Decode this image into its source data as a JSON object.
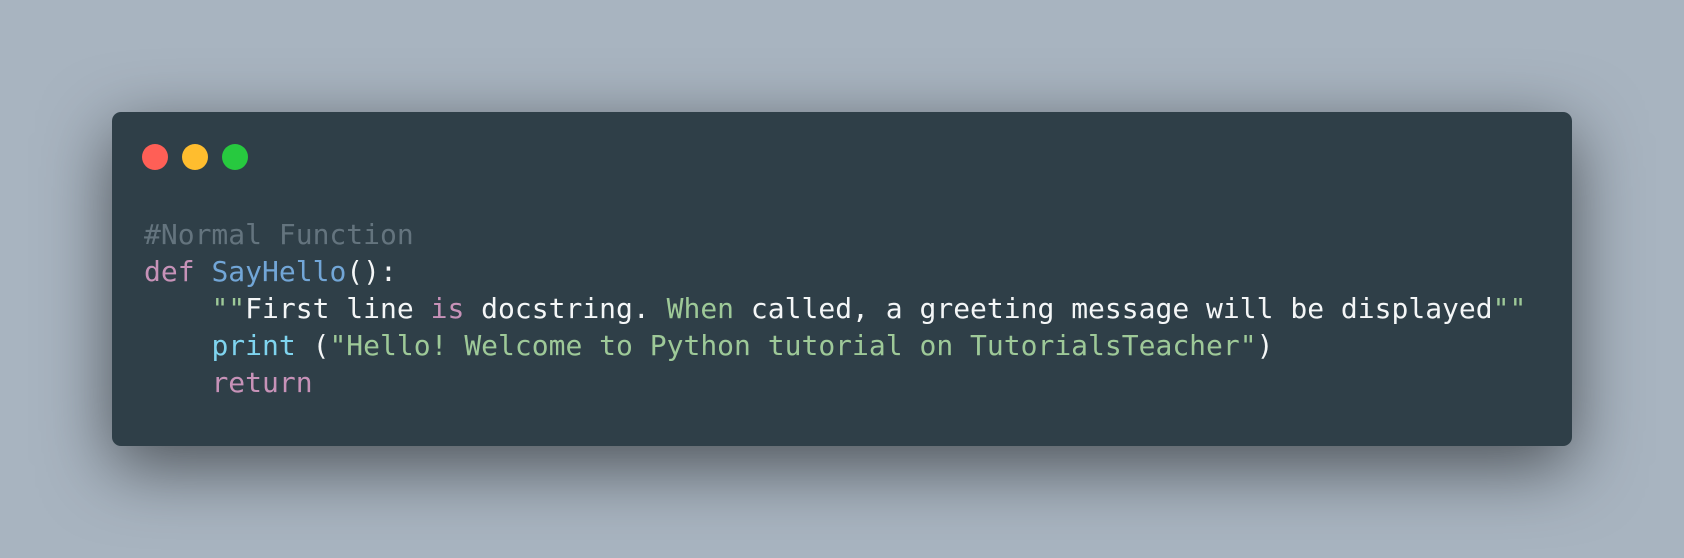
{
  "window": {
    "controls": {
      "close": "close",
      "minimize": "minimize",
      "maximize": "maximize"
    }
  },
  "code": {
    "comment": "#Normal Function",
    "line2": {
      "kw": "def",
      "fn": "SayHello",
      "rest": "():"
    },
    "line3": {
      "indent": "    ",
      "quote_open": "\"\"",
      "text1": "First line ",
      "kw": "is",
      "text2": " docstring. ",
      "highlight": "When",
      "text3": " called, a greeting message will be displayed",
      "quote_close": "\"\""
    },
    "line4": {
      "indent": "    ",
      "builtin": "print",
      "open_paren": " (",
      "string": "\"Hello! Welcome to Python tutorial on TutorialsTeacher\"",
      "close_paren": ")"
    },
    "line5": {
      "indent": "    ",
      "kw": "return"
    }
  },
  "colors": {
    "background": "#a8b4c0",
    "window": "#2f3f48",
    "comment": "#64747e",
    "keyword": "#c792b8",
    "function": "#72a6d7",
    "builtin": "#7fd4ef",
    "string": "#9ec998",
    "text": "#f4f6f7"
  }
}
